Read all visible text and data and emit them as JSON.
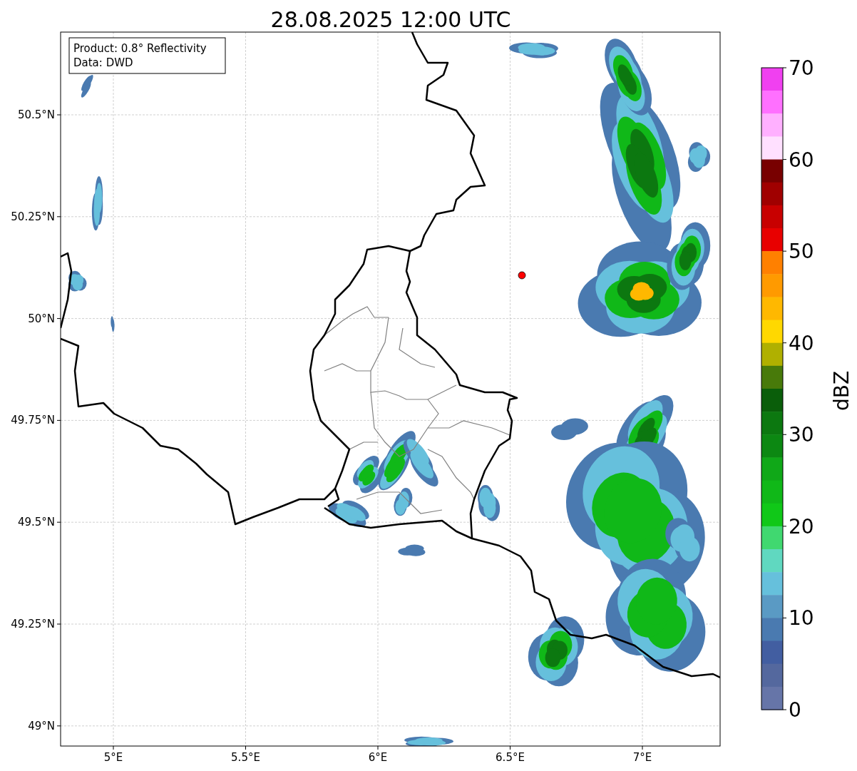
{
  "title": "28.08.2025 12:00 UTC",
  "map": {
    "legend": [
      "Product: 0.8° Reflectivity",
      "Data: DWD"
    ],
    "x_ticks": [
      "5°E",
      "5.5°E",
      "6°E",
      "6.5°E",
      "7°E"
    ],
    "y_ticks": [
      "50.5°N",
      "50.25°N",
      "50°N",
      "49.75°N",
      "49.5°N",
      "49.25°N",
      "49°N"
    ]
  },
  "colorbar": {
    "label": "dBZ",
    "ticks": [
      "70",
      "60",
      "50",
      "40",
      "30",
      "20",
      "10",
      "0"
    ],
    "bins": [
      {
        "color": "#f040f0"
      },
      {
        "color": "#ff70ff"
      },
      {
        "color": "#ffb0ff"
      },
      {
        "color": "#ffe0ff"
      },
      {
        "color": "#780000"
      },
      {
        "color": "#a00000"
      },
      {
        "color": "#c80000"
      },
      {
        "color": "#e80000"
      },
      {
        "color": "#ff8000"
      },
      {
        "color": "#ff9a00"
      },
      {
        "color": "#ffb800"
      },
      {
        "color": "#ffd800"
      },
      {
        "color": "#b0b000"
      },
      {
        "color": "#487a0a"
      },
      {
        "color": "#0a5e0a"
      },
      {
        "color": "#0c7810"
      },
      {
        "color": "#0c8812"
      },
      {
        "color": "#10a818"
      },
      {
        "color": "#10b818"
      },
      {
        "color": "#10c818"
      },
      {
        "color": "#40d870"
      },
      {
        "color": "#60d8c0"
      },
      {
        "color": "#66c0dc"
      },
      {
        "color": "#5a9ac4"
      },
      {
        "color": "#4a7ab0"
      },
      {
        "color": "#425ea1"
      },
      {
        "color": "#54689e"
      },
      {
        "color": "#6675a8"
      }
    ]
  }
}
